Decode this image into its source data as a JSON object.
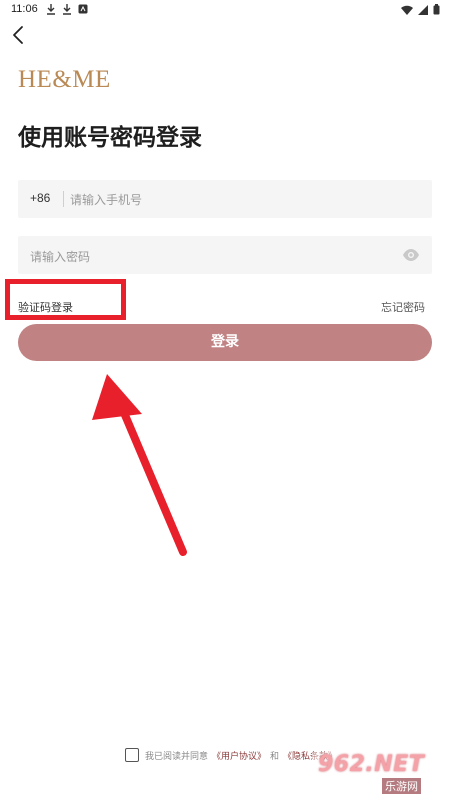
{
  "status_bar": {
    "time": "11:06"
  },
  "header": {
    "logo_text": "HE&ME",
    "title": "使用账号密码登录"
  },
  "form": {
    "country_code": "+86",
    "phone_placeholder": "请输入手机号",
    "password_placeholder": "请输入密码",
    "sms_login_label": "验证码登录",
    "forgot_password_label": "忘记密码",
    "login_button_label": "登录"
  },
  "agreement": {
    "prefix": "我已阅读并同意",
    "user_agreement": "《用户协议》",
    "and": "和",
    "privacy_policy": "《隐私条款》"
  },
  "watermark": {
    "brand": "962.NET",
    "sub": "乐游网"
  },
  "colors": {
    "accent": "#c08283",
    "logo": "#b98a56",
    "annotation_red": "#e8202c"
  }
}
